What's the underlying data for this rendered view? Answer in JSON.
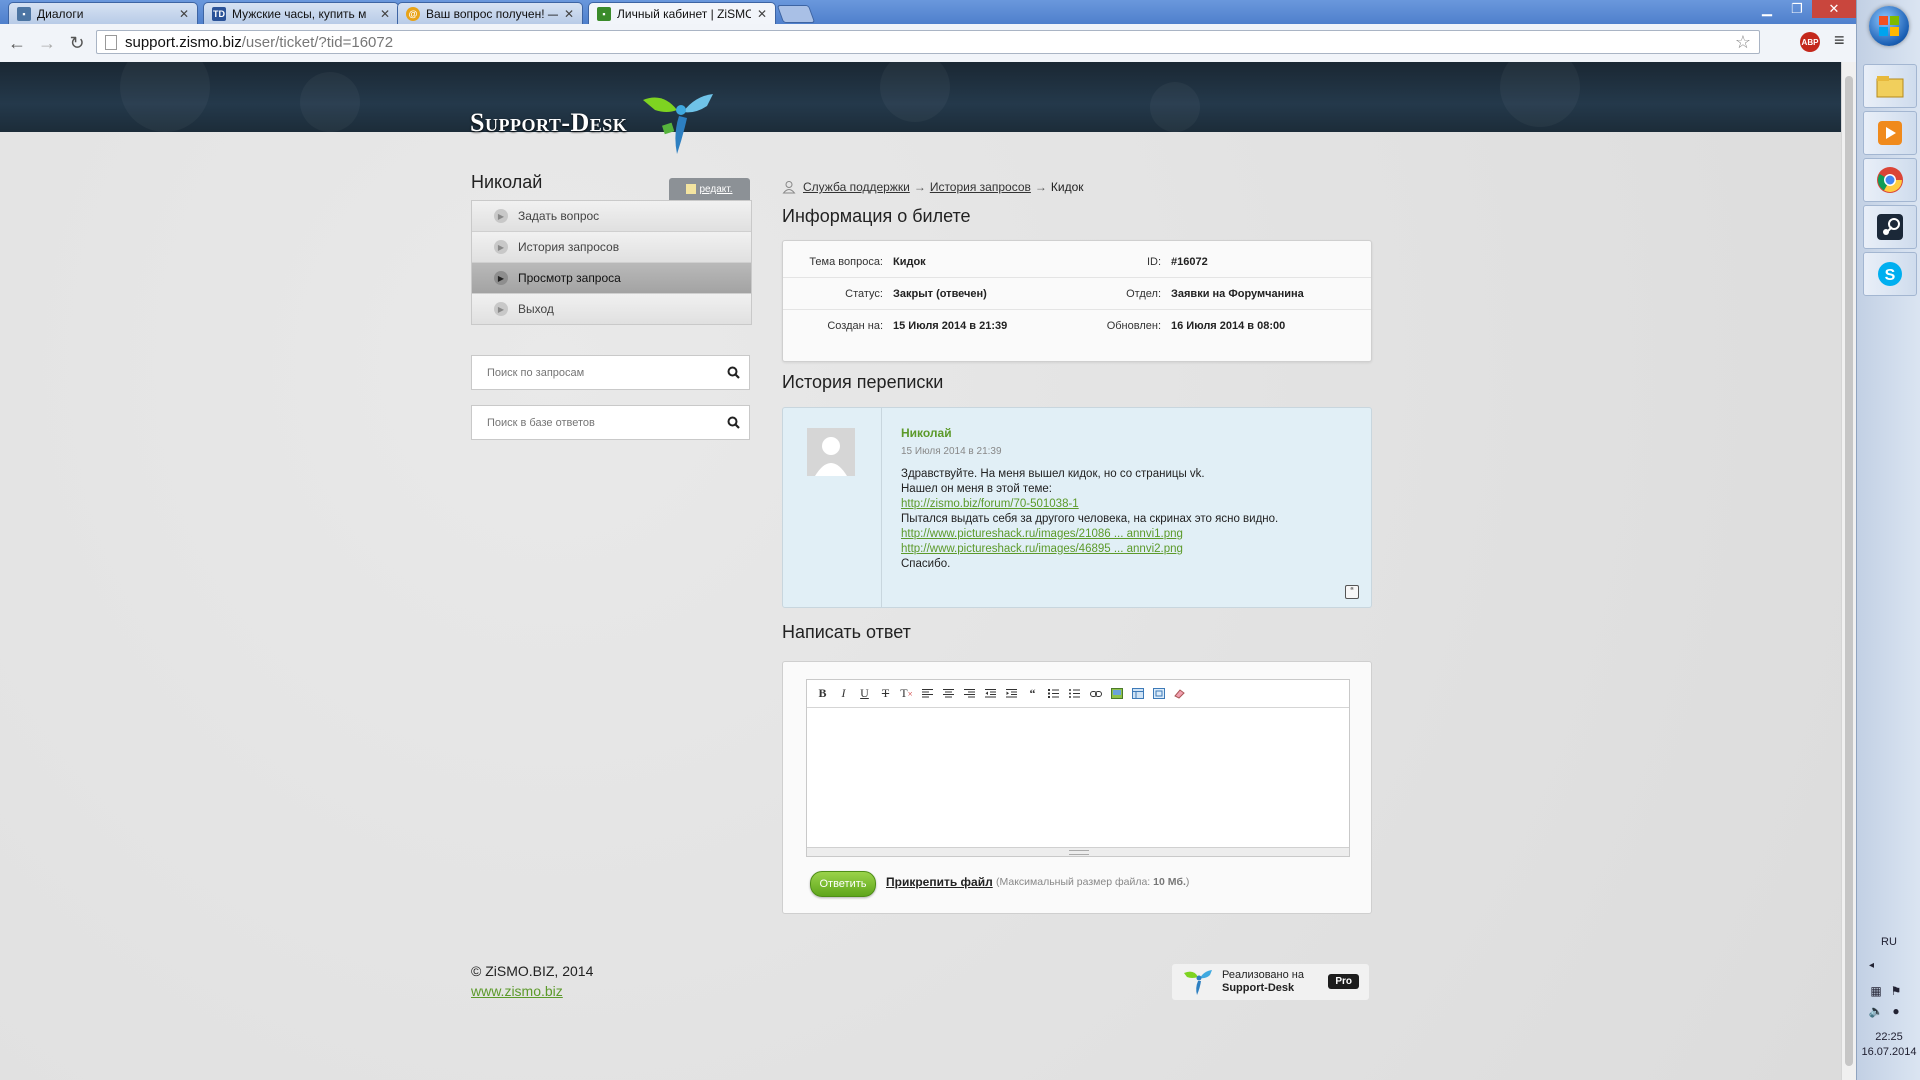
{
  "browser": {
    "tabs": [
      {
        "title": "Диалоги",
        "favicon": "vk-icon",
        "color": "#4c75a3"
      },
      {
        "title": "Мужские часы, купить м",
        "favicon": "td-icon",
        "color": "#2a5298"
      },
      {
        "title": "Ваш вопрос получен! —",
        "favicon": "at-mail-icon",
        "color": "#e8a317"
      },
      {
        "title": "Личный кабинет | ZiSMO",
        "favicon": "support-desk-icon",
        "color": "#3a8b2a"
      }
    ],
    "url_host": "support.zismo.biz",
    "url_path": "/user/ticket/?tid=16072",
    "abp_label": "ABP"
  },
  "site": {
    "logo_text": "Support-Desk",
    "user_name": "Николай",
    "edit_label": "редакт.",
    "menu": [
      {
        "label": "Задать вопрос",
        "active": false
      },
      {
        "label": "История запросов",
        "active": false
      },
      {
        "label": "Просмотр запроса",
        "active": true
      },
      {
        "label": "Выход",
        "active": false
      }
    ],
    "search_requests_placeholder": "Поиск по запросам",
    "search_answers_placeholder": "Поиск в базе ответов",
    "breadcrumb": {
      "items": [
        "Служба поддержки",
        "История запросов"
      ],
      "separator": "→",
      "current": "Кидок"
    },
    "ticket_info": {
      "title": "Информация о билете",
      "rows": [
        {
          "label1": "Тема вопроса:",
          "value1": "Кидок",
          "label2": "ID:",
          "value2": "#16072"
        },
        {
          "label1": "Статус:",
          "value1": "Закрыт (отвечен)",
          "label2": "Отдел:",
          "value2": "Заявки на Форумчанина"
        },
        {
          "label1": "Создан на:",
          "value1": "15 Июля 2014 в 21:39",
          "label2": "Обновлен:",
          "value2": "16 Июля 2014 в 08:00"
        }
      ]
    },
    "history": {
      "title": "История переписки",
      "message": {
        "author": "Николай",
        "date": "15 Июля 2014 в 21:39",
        "line1": "Здравствуйте. На меня вышел кидок, но со страницы vk.",
        "line2": "Нашел он меня в этой теме:",
        "link1": "http://zismo.biz/forum/70-501038-1",
        "line3": "Пытался выдать себя за другого человека, на скринах это ясно видно.",
        "link2": "http://www.pictureshack.ru/images/21086 ... annvi1.png",
        "link3": "http://www.pictureshack.ru/images/46895 ... annvi2.png",
        "line4": "Спасибо."
      }
    },
    "reply": {
      "title": "Написать ответ",
      "toolbar": [
        "bold",
        "italic",
        "underline",
        "strikethrough",
        "remove-format",
        "align-left",
        "align-center",
        "align-right",
        "outdent",
        "indent",
        "blockquote",
        "ordered-list",
        "unordered-list",
        "link",
        "image",
        "table",
        "fullscreen",
        "eraser"
      ],
      "submit_label": "Ответить",
      "attach_label": "Прикрепить файл",
      "attach_note_prefix": "(Максимальный размер файла: ",
      "attach_note_size": "10 Мб.",
      "attach_note_suffix": ")"
    },
    "footer": {
      "copyright": "© ZiSMO.BIZ, 2014",
      "site_link": "www.zismo.biz",
      "powered_line1": "Реализовано на",
      "powered_line2": "Support-Desk",
      "powered_badge": "Pro"
    },
    "colors": {
      "accent_green": "#5c9a2a",
      "header_dark": "#1c2c39",
      "message_bg": "#e1eff6"
    }
  },
  "taskbar": {
    "apps": [
      "file-explorer-icon",
      "media-player-icon",
      "chrome-icon",
      "steam-icon",
      "skype-icon"
    ],
    "language": "RU",
    "time": "22:25",
    "date": "16.07.2014"
  }
}
